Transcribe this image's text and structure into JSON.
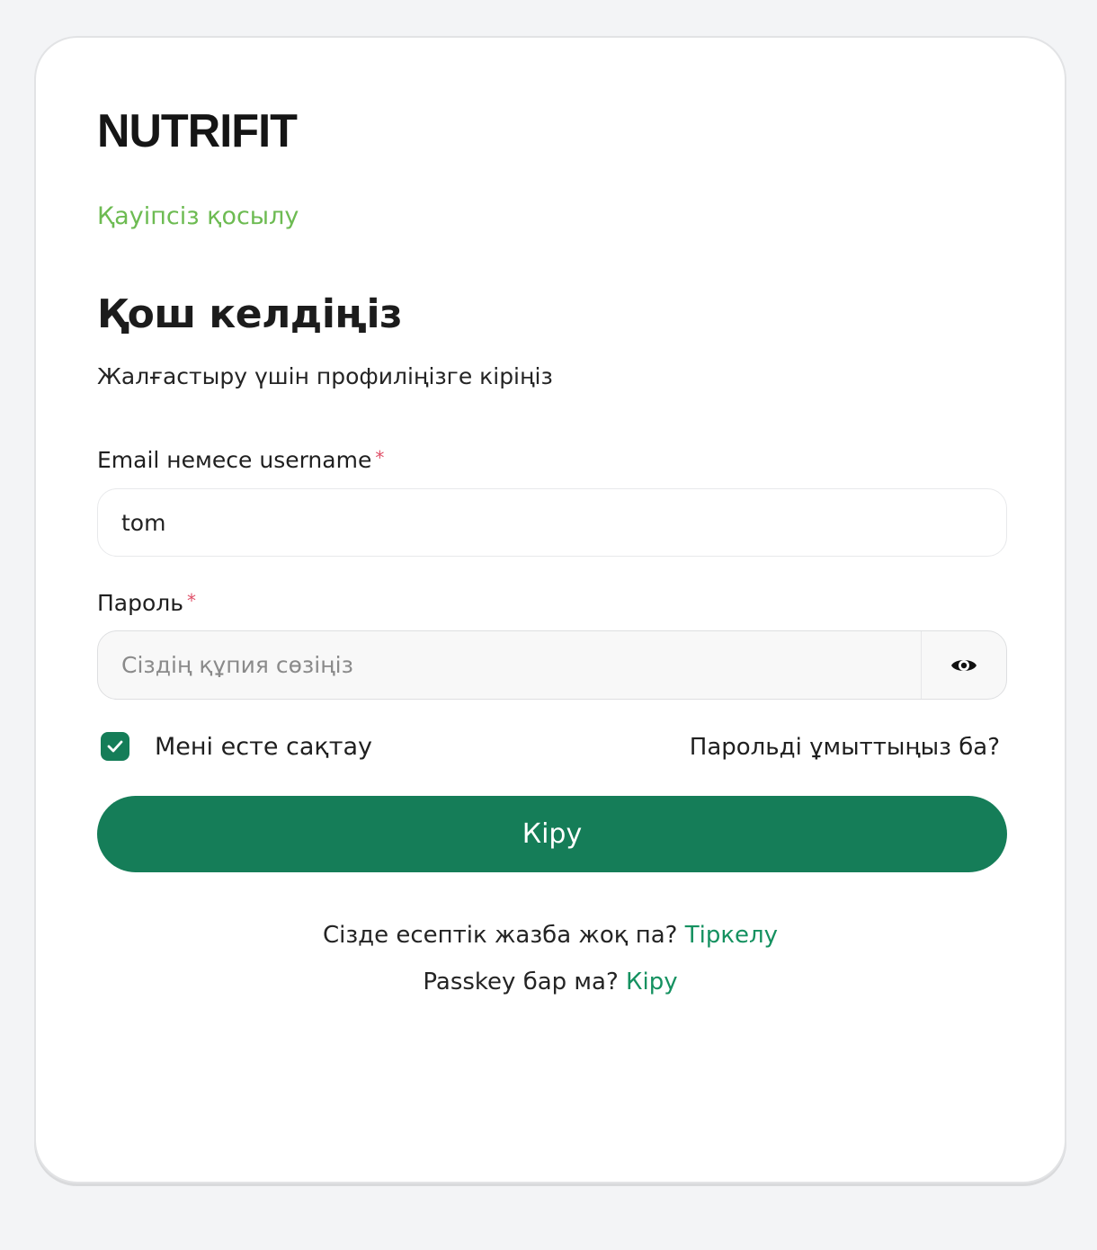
{
  "brand": {
    "logo_text": "NUTRIFIT",
    "secure_label": "Қауіпсіз қосылу",
    "secure_color": "#6dbb52"
  },
  "heading": {
    "title": "Қош келдіңіз",
    "subtitle": "Жалғастыру үшін профиліңізге кіріңіз"
  },
  "form": {
    "email_label": "Email немесе username",
    "email_value": "tom",
    "password_label": "Пароль",
    "password_placeholder": "Сіздің құпия сөзіңіз",
    "required_marker": "*",
    "remember_label": "Мені есте сақтау",
    "remember_checked": true,
    "forgot_label": "Парольді ұмыттыңыз ба?",
    "submit_label": "Кіру",
    "accent_color": "#157d58"
  },
  "footer": {
    "signup_prompt": "Сізде есептік жазба жоқ па?",
    "signup_link": "Тіркелу",
    "passkey_prompt": "Passkey бар ма?",
    "passkey_link": "Кіру",
    "link_color": "#159160"
  },
  "icons": {
    "password_toggle": "eye-icon",
    "checkbox_mark": "check-icon"
  }
}
